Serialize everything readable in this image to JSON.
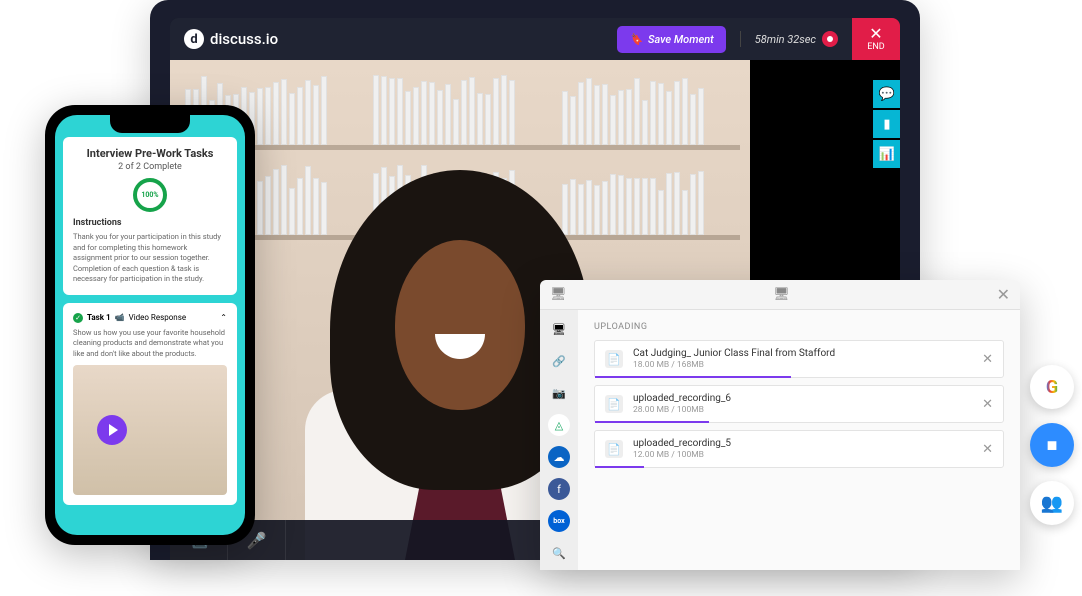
{
  "app": {
    "brand": "discuss.io",
    "save_label": "Save Moment",
    "timer": "58min 32sec",
    "end_label": "END"
  },
  "phone": {
    "title": "Interview Pre-Work Tasks",
    "progress": "2 of 2 Complete",
    "ring_label": "100%",
    "instructions_heading": "Instructions",
    "instructions_body": "Thank you for your participation in this study and for completing this homework assignment prior to our session together. Completion of each question & task is necessary for participation in the study.",
    "task1_label": "Task 1",
    "task1_type": "Video Response",
    "task1_chevron": "⌃",
    "task1_prompt": "Show us how you use your favorite household cleaning products and demonstrate what you like and don't like about the products."
  },
  "upload": {
    "section_title": "UPLOADING",
    "files": [
      {
        "name": "Cat Judging_ Junior Class Final from Stafford",
        "size": "18.00 MB / 168MB",
        "progress": 48
      },
      {
        "name": "uploaded_recording_6",
        "size": "28.00 MB / 100MB",
        "progress": 28
      },
      {
        "name": "uploaded_recording_5",
        "size": "12.00 MB / 100MB",
        "progress": 12
      }
    ],
    "sources": [
      {
        "name": "device",
        "glyph": "🖥"
      },
      {
        "name": "link",
        "glyph": "🔗"
      },
      {
        "name": "camera",
        "glyph": "📷"
      },
      {
        "name": "google-drive",
        "glyph": "◬",
        "bg": "#fff",
        "color": "#18a862"
      },
      {
        "name": "onedrive",
        "glyph": "☁",
        "bg": "#0a64c4",
        "color": "#fff"
      },
      {
        "name": "facebook",
        "glyph": "f",
        "bg": "#3b5998",
        "color": "#fff"
      },
      {
        "name": "box",
        "glyph": "box",
        "bg": "#0061d5",
        "color": "#fff"
      },
      {
        "name": "search",
        "glyph": "🔍"
      }
    ]
  },
  "integrations": [
    {
      "name": "google",
      "glyph": "G"
    },
    {
      "name": "zoom",
      "glyph": "■",
      "bg": "#2d8cff",
      "color": "#fff"
    },
    {
      "name": "teams",
      "glyph": "👥",
      "bg": "#fff",
      "color": "#5558af"
    }
  ]
}
